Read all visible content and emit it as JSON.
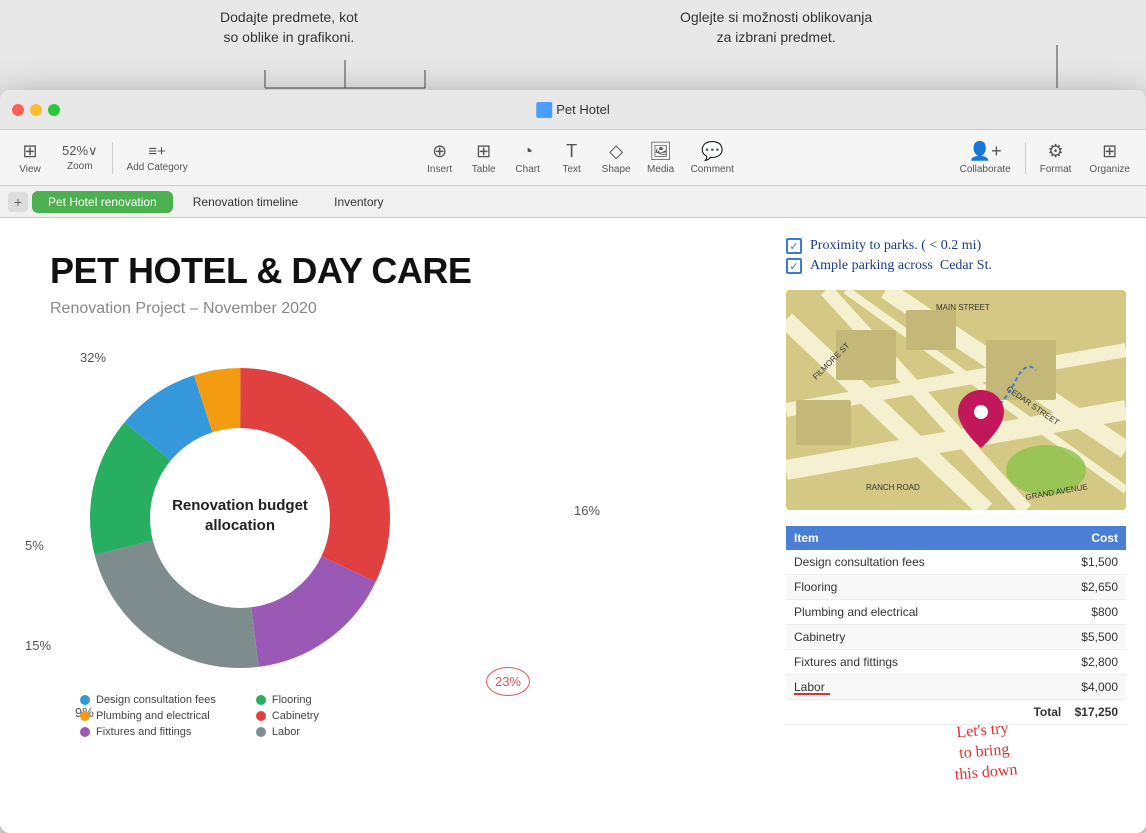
{
  "callouts": {
    "left": "Dodajte predmete, kot\nso oblike in grafikoni.",
    "right": "Oglejte si možnosti oblikovanja\nza izbrani predmet."
  },
  "window": {
    "title": "Pet Hotel",
    "doc_icon_color": "#4a9eff"
  },
  "toolbar": {
    "view_label": "View",
    "zoom_label": "Zoom",
    "zoom_value": "52%",
    "add_category_label": "Add Category",
    "insert_label": "Insert",
    "table_label": "Table",
    "chart_label": "Chart",
    "text_label": "Text",
    "shape_label": "Shape",
    "media_label": "Media",
    "comment_label": "Comment",
    "collaborate_label": "Collaborate",
    "format_label": "Format",
    "organize_label": "Organize"
  },
  "tabs": [
    {
      "label": "Pet Hotel renovation",
      "active": true
    },
    {
      "label": "Renovation timeline",
      "active": false
    },
    {
      "label": "Inventory",
      "active": false
    }
  ],
  "slide": {
    "title": "PET HOTEL & DAY CARE",
    "subtitle": "Renovation Project – November 2020",
    "chart": {
      "center_label_line1": "Renovation budget",
      "center_label_line2": "allocation",
      "percentages": {
        "p32": "32%",
        "p16": "16%",
        "p5": "5%",
        "p15": "15%",
        "p9": "9%",
        "p23": "23%"
      },
      "segments": [
        {
          "label": "Cabinetry",
          "color": "#e04040",
          "percent": 32
        },
        {
          "label": "Fixtures and fittings",
          "color": "#9b59b6",
          "percent": 16
        },
        {
          "label": "Labor",
          "color": "#7f8c8d",
          "percent": 23
        },
        {
          "label": "Flooring",
          "color": "#27ae60",
          "percent": 15
        },
        {
          "label": "Design consultation fees",
          "color": "#3498db",
          "percent": 9
        },
        {
          "label": "Plumbing and electrical",
          "color": "#f39c12",
          "percent": 5
        }
      ]
    },
    "legend": [
      {
        "label": "Design consultation fees",
        "color": "#3498db"
      },
      {
        "label": "Flooring",
        "color": "#27ae60"
      },
      {
        "label": "Plumbing and electrical",
        "color": "#f39c12"
      },
      {
        "label": "Cabinetry",
        "color": "#e04040"
      },
      {
        "label": "Fixtures and fittings",
        "color": "#9b59b6"
      },
      {
        "label": "Labor",
        "color": "#7f8c8d"
      }
    ],
    "checklist": [
      "Proximity to parks. ( < 0.2 mi)",
      "Ample parking across  Cedar St."
    ],
    "table": {
      "headers": [
        "Item",
        "Cost"
      ],
      "rows": [
        {
          "item": "Design consultation fees",
          "cost": "$1,500"
        },
        {
          "item": "Flooring",
          "cost": "$2,650"
        },
        {
          "item": "Plumbing and electrical",
          "cost": "$800"
        },
        {
          "item": "Cabinetry",
          "cost": "$5,500"
        },
        {
          "item": "Fixtures and fittings",
          "cost": "$2,800"
        },
        {
          "item": "Labor",
          "cost": "$4,000",
          "highlight": true
        }
      ],
      "total_label": "Total",
      "total_value": "$17,250"
    },
    "annotation": "Let's try\nto bring\nthis down"
  }
}
